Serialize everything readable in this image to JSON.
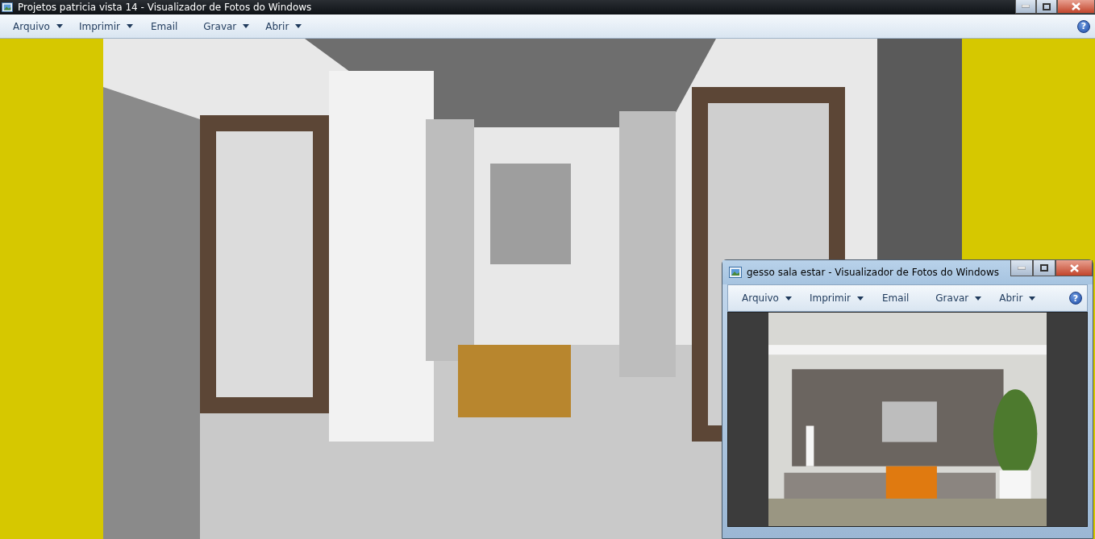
{
  "windows": [
    {
      "title": "Projetos patricia vista 14 - Visualizador de Fotos do Windows",
      "active": true,
      "menu": [
        {
          "label": "Arquivo",
          "dropdown": true
        },
        {
          "label": "Imprimir",
          "dropdown": true
        },
        {
          "label": "Email",
          "dropdown": false
        },
        {
          "label": "Gravar",
          "dropdown": true
        },
        {
          "label": "Abrir",
          "dropdown": true
        }
      ],
      "help": "?"
    },
    {
      "title": "gesso sala estar - Visualizador de Fotos do Windows",
      "active": false,
      "menu": [
        {
          "label": "Arquivo",
          "dropdown": true
        },
        {
          "label": "Imprimir",
          "dropdown": true
        },
        {
          "label": "Email",
          "dropdown": false
        },
        {
          "label": "Gravar",
          "dropdown": true
        },
        {
          "label": "Abrir",
          "dropdown": true
        }
      ],
      "help": "?"
    }
  ]
}
